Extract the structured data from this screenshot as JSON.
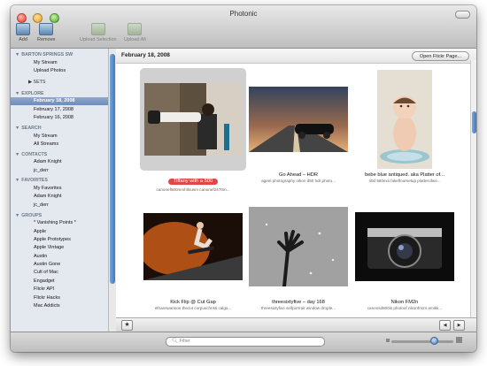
{
  "window": {
    "title": "Photonic"
  },
  "toolbar": {
    "add": "Add",
    "remove": "Remove",
    "upload_selection": "Upload Selection",
    "upload_all": "Upload All"
  },
  "sidebar": {
    "account": {
      "title": "BARTON SPRINGS SW",
      "items": [
        "My Stream",
        "Upload Photos"
      ],
      "sets_label": "SETS"
    },
    "explore": {
      "title": "EXPLORE",
      "items": [
        "February 18, 2008",
        "February 17, 2008",
        "February 16, 2008"
      ],
      "selected": "February 18, 2008"
    },
    "search": {
      "title": "SEARCH",
      "items": [
        "My Stream",
        "All Streams"
      ]
    },
    "contacts": {
      "title": "CONTACTS",
      "items": [
        "Adam Knight",
        "jc_derr"
      ]
    },
    "favorites": {
      "title": "FAVORITES",
      "items": [
        "My Favorites",
        "Adam Knight",
        "jc_derr"
      ]
    },
    "groups": {
      "title": "GROUPS",
      "items": [
        "* Vanishing Points *",
        "Apple",
        "Apple Prototypes",
        "Apple Vintage",
        "Austin",
        "Austin Gone",
        "Cult of Mac",
        "Engadget",
        "Flickr API",
        "Flickr Hacks",
        "Mac Addicts"
      ]
    }
  },
  "content": {
    "date_header": "February 18, 2008",
    "open_button": "Open Flickr Page...",
    "photos": [
      {
        "title": "Tiffany with a 500",
        "tags": "canonef500mmf4lsusm canonef2470m...",
        "selected": true
      },
      {
        "title": "Go Ahead – HDR",
        "tags": "ageel photography nikon d50 hdr photo..."
      },
      {
        "title": "bebe blue antiqued. aka Platter of...",
        "tags": "40d 580exii fakefloorsetup platterofwe..."
      },
      {
        "title": "Kick Flip @ Cut Gap",
        "tags": "ethanswanson thecut corpuschristi calga..."
      },
      {
        "title": "threesixtyfive – day 168",
        "tags": "threesixtyfive selfportrait window drople..."
      },
      {
        "title": "Nikon FM2n",
        "tags": "canonsd800is photoof nikonfm2n amikk..."
      }
    ]
  },
  "bottom": {
    "star": "★",
    "prev": "◀",
    "next": "▶"
  },
  "status": {
    "filter_placeholder": "Filter"
  },
  "colors": {
    "selection_blue": "#6d8cba",
    "selected_title_red": "#e04848",
    "scroll_blue": "#3d78c6"
  }
}
